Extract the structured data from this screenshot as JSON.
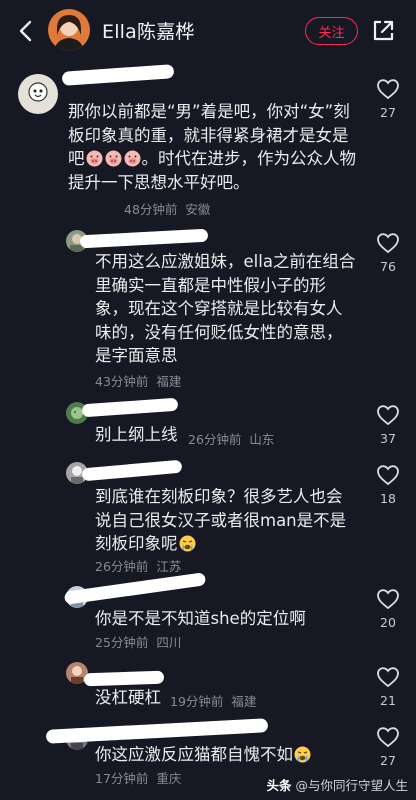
{
  "header": {
    "title": "Ella陈嘉桦",
    "follow_label": "关注"
  },
  "comments": [
    {
      "text": "那你以前都是“男”着是吧，你对“女”刻板印象真的重，就非得紧身裙才是女是吧",
      "text_after": "。时代在进步，作为公众人物提升一下思想水平好吧。",
      "time": "48分钟前",
      "location": "安徽",
      "likes": "27"
    },
    {
      "text": "不用这么应激姐妹，ella之前在组合里确实一直都是中性假小子的形象，现在这个穿搭就是比较有女人味的，没有任何贬低女性的意思，是字面意思",
      "time": "43分钟前",
      "location": "福建",
      "likes": "76"
    },
    {
      "text": "别上纲上线",
      "time": "26分钟前",
      "location": "山东",
      "likes": "37"
    },
    {
      "text": "到底谁在刻板印象？很多艺人也会说自己很女汉子或者很man是不是刻板印象呢",
      "time": "26分钟前",
      "location": "江苏",
      "likes": "18"
    },
    {
      "text": "你是不是不知道she的定位啊",
      "time": "25分钟前",
      "location": "四川",
      "likes": "20"
    },
    {
      "text": "没杠硬杠",
      "time": "19分钟前",
      "location": "福建",
      "likes": "21"
    },
    {
      "text": "你这应激反应猫都自愧不如",
      "time": "17分钟前",
      "location": "重庆",
      "likes": "27"
    }
  ],
  "watermark": {
    "brand": "头条",
    "handle": "@与你同行守望人生"
  }
}
